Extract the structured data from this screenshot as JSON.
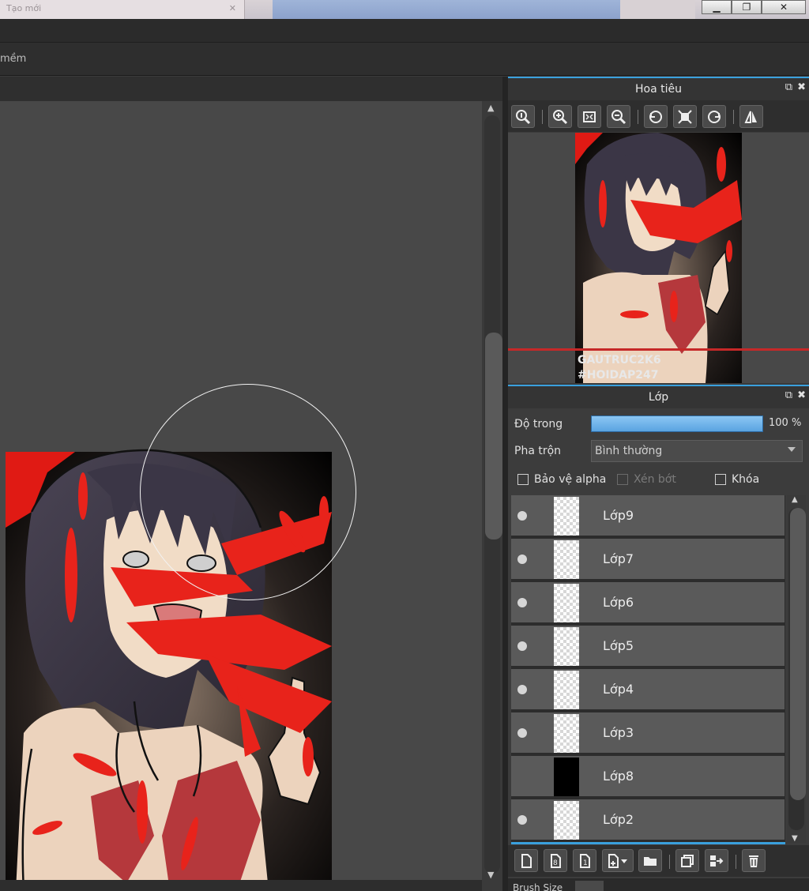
{
  "window": {
    "tab_title": "Tạo mới",
    "controls": [
      "minimize",
      "restore",
      "close"
    ]
  },
  "toolbar2": {
    "label": "mềm"
  },
  "navigator": {
    "title": "Hoa tiêu",
    "tools": [
      "zoom-actual-icon",
      "zoom-in-icon",
      "fit-window-icon",
      "zoom-out-icon",
      "rotate-left-icon",
      "rotate-reset-icon",
      "rotate-right-icon",
      "flip-horizontal-icon"
    ],
    "preview_watermark": [
      "GAUTRUC2K6",
      "#HOIDAP247"
    ]
  },
  "layers_panel": {
    "title": "Lớp",
    "opacity_label": "Độ trong",
    "opacity_value": "100 %",
    "opacity_fraction": 1.0,
    "blend_label": "Pha trộn",
    "blend_mode": "Bình thường",
    "protect_alpha": "Bảo vệ alpha",
    "clipping": "Xén bớt",
    "lock": "Khóa",
    "layers": [
      {
        "name": "Lớp9",
        "visible": true,
        "thumb": "transparent"
      },
      {
        "name": "Lớp7",
        "visible": true,
        "thumb": "transparent"
      },
      {
        "name": "Lớp6",
        "visible": true,
        "thumb": "transparent"
      },
      {
        "name": "Lớp5",
        "visible": true,
        "thumb": "transparent"
      },
      {
        "name": "Lớp4",
        "visible": true,
        "thumb": "transparent"
      },
      {
        "name": "Lớp3",
        "visible": true,
        "thumb": "transparent"
      },
      {
        "name": "Lớp8",
        "visible": false,
        "thumb": "black"
      },
      {
        "name": "Lớp2",
        "visible": true,
        "thumb": "transparent"
      }
    ],
    "tools": [
      "new-layer-icon",
      "new-8bit-layer-icon",
      "new-1bit-layer-icon",
      "add-layer-menu-icon",
      "folder-icon",
      "duplicate-layer-icon",
      "merge-layer-icon",
      "delete-layer-icon"
    ]
  },
  "brush_bar": {
    "label": "Brush Size"
  },
  "colors": {
    "accent": "#3aa0dd",
    "blood": "#e8231b",
    "hair": "#3b3646",
    "skin": "#ecd3bd"
  }
}
